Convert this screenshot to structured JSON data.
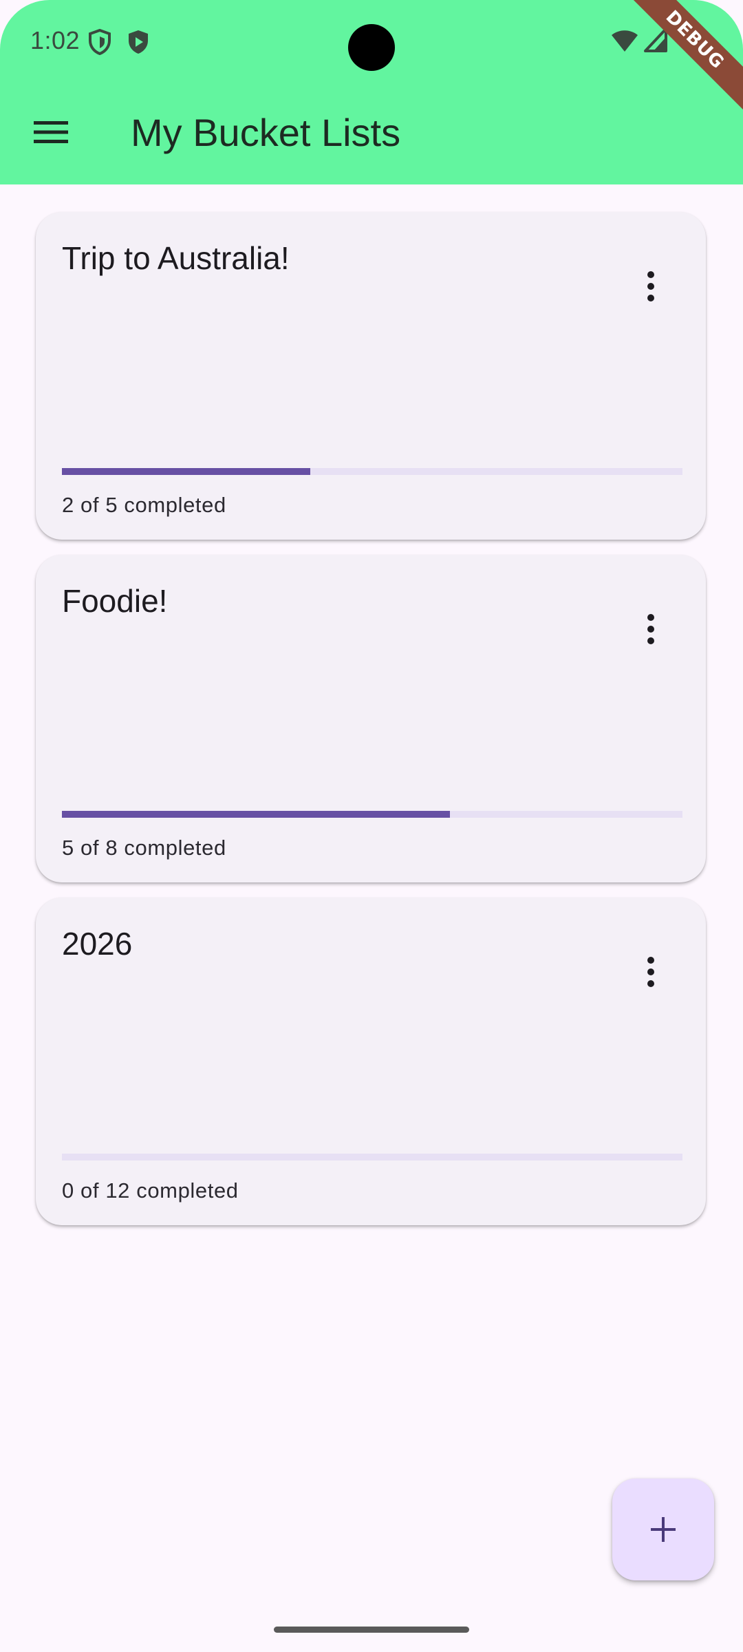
{
  "status_bar": {
    "time": "1:02",
    "icons": [
      "shield-outline-icon",
      "play-protect-icon",
      "wifi-icon",
      "cell-signal-icon"
    ],
    "debug_banner": "DEBUG"
  },
  "app_bar": {
    "menu_icon": "hamburger-menu-icon",
    "title": "My Bucket Lists",
    "color": "#62f59f"
  },
  "lists": [
    {
      "title": "Trip to Australia!",
      "completed": 2,
      "total": 5,
      "progress_fraction": 0.4,
      "status_text": "2 of 5 completed"
    },
    {
      "title": "Foodie!",
      "completed": 5,
      "total": 8,
      "progress_fraction": 0.625,
      "status_text": "5 of 8 completed"
    },
    {
      "title": "2026",
      "completed": 0,
      "total": 12,
      "progress_fraction": 0,
      "status_text": "0 of 12 completed"
    }
  ],
  "card_menu_icon": "more-vert-icon",
  "fab": {
    "icon": "plus-icon",
    "color": "#eaddff"
  },
  "colors": {
    "progress_fill": "#6750a4",
    "progress_track": "#e7e0f4",
    "card_background": "#f4f0f7",
    "page_background": "#fdf7fe"
  }
}
